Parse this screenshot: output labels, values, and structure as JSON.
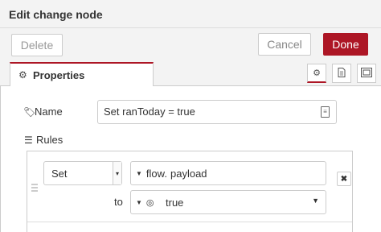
{
  "dialog": {
    "title": "Edit change node"
  },
  "toolbar": {
    "delete_label": "Delete",
    "cancel_label": "Cancel",
    "done_label": "Done"
  },
  "tabs": {
    "properties_label": "Properties",
    "icons": [
      "gear-icon",
      "description-icon",
      "appearance-icon"
    ]
  },
  "form": {
    "name_label": "Name",
    "name_value": "Set ranToday = true",
    "rules_label": "Rules",
    "rules": [
      {
        "action": "Set",
        "target_type": "flow.",
        "target_value": "payload",
        "to_label": "to",
        "value_type_icon": "boolean-icon",
        "value": "true"
      }
    ]
  },
  "colors": {
    "primary": "#ad1625",
    "toolbar_bg": "#f3f3f3",
    "border": "#cccccc"
  }
}
